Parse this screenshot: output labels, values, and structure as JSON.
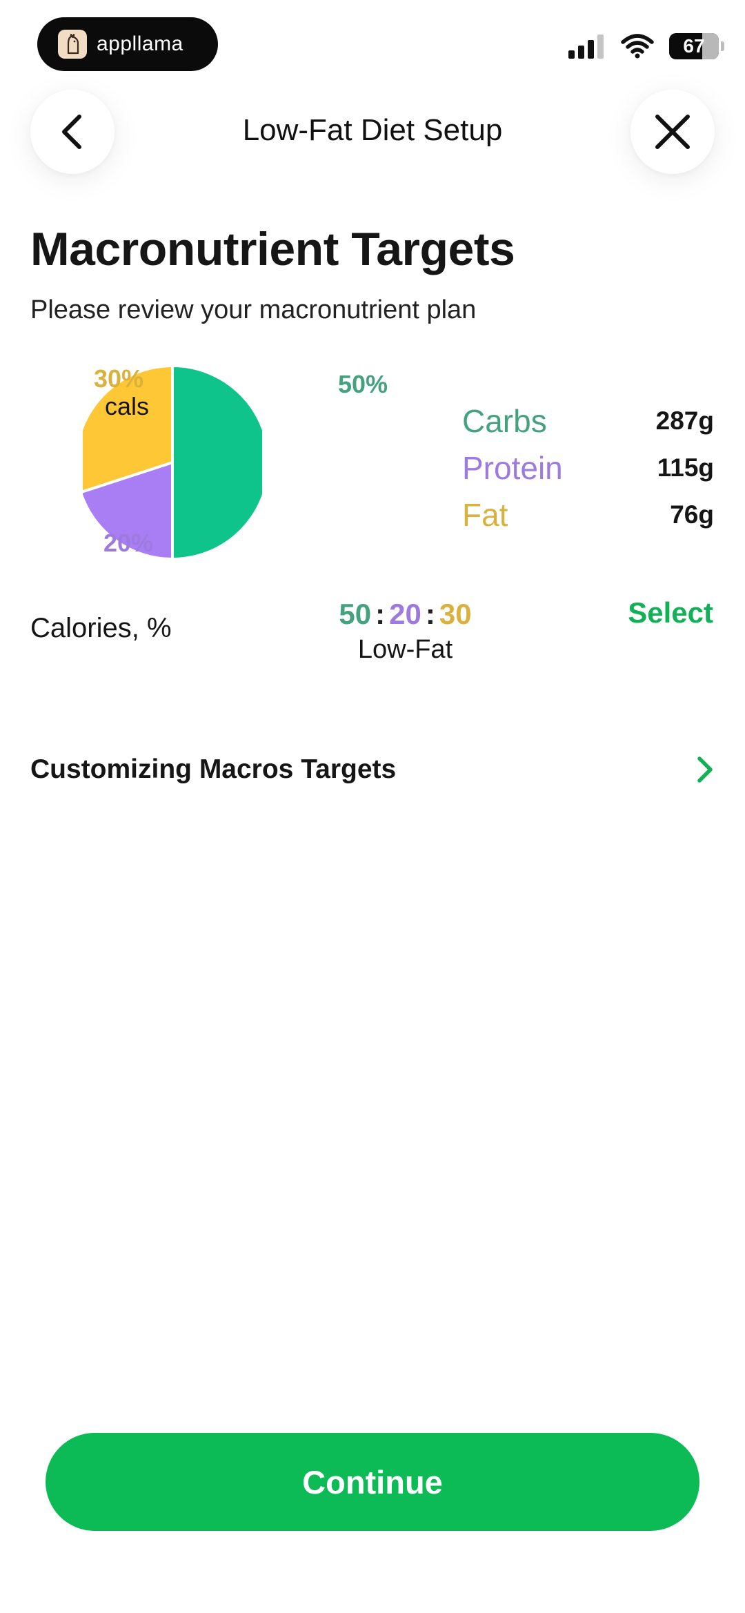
{
  "status_bar": {
    "brand": "appllama",
    "battery": "67"
  },
  "header": {
    "title": "Low-Fat Diet Setup"
  },
  "main": {
    "title": "Macronutrient Targets",
    "subtitle": "Please review your macronutrient plan"
  },
  "pie": {
    "labels": {
      "carbs": "50%",
      "protein": "20%",
      "fat": "30%",
      "unit": "cals"
    },
    "colors": {
      "carbs": "#0fc48a",
      "protein": "#a97ef5",
      "fat": "#fdc735"
    }
  },
  "macros": [
    {
      "name": "Carbs",
      "value": "287g",
      "color": "#45a27e"
    },
    {
      "name": "Protein",
      "value": "115g",
      "color": "#9d7ae0"
    },
    {
      "name": "Fat",
      "value": "76g",
      "color": "#d9b23d"
    }
  ],
  "calories": {
    "label": "Calories, %",
    "ratio": {
      "carbs": "50",
      "protein": "20",
      "fat": "30",
      "sep": ":"
    },
    "plan": "Low-Fat",
    "select_label": "Select"
  },
  "customize": {
    "label": "Customizing Macros Targets"
  },
  "footer": {
    "continue_label": "Continue"
  },
  "colors": {
    "accent": "#0cbb55",
    "link": "#13b157"
  }
}
